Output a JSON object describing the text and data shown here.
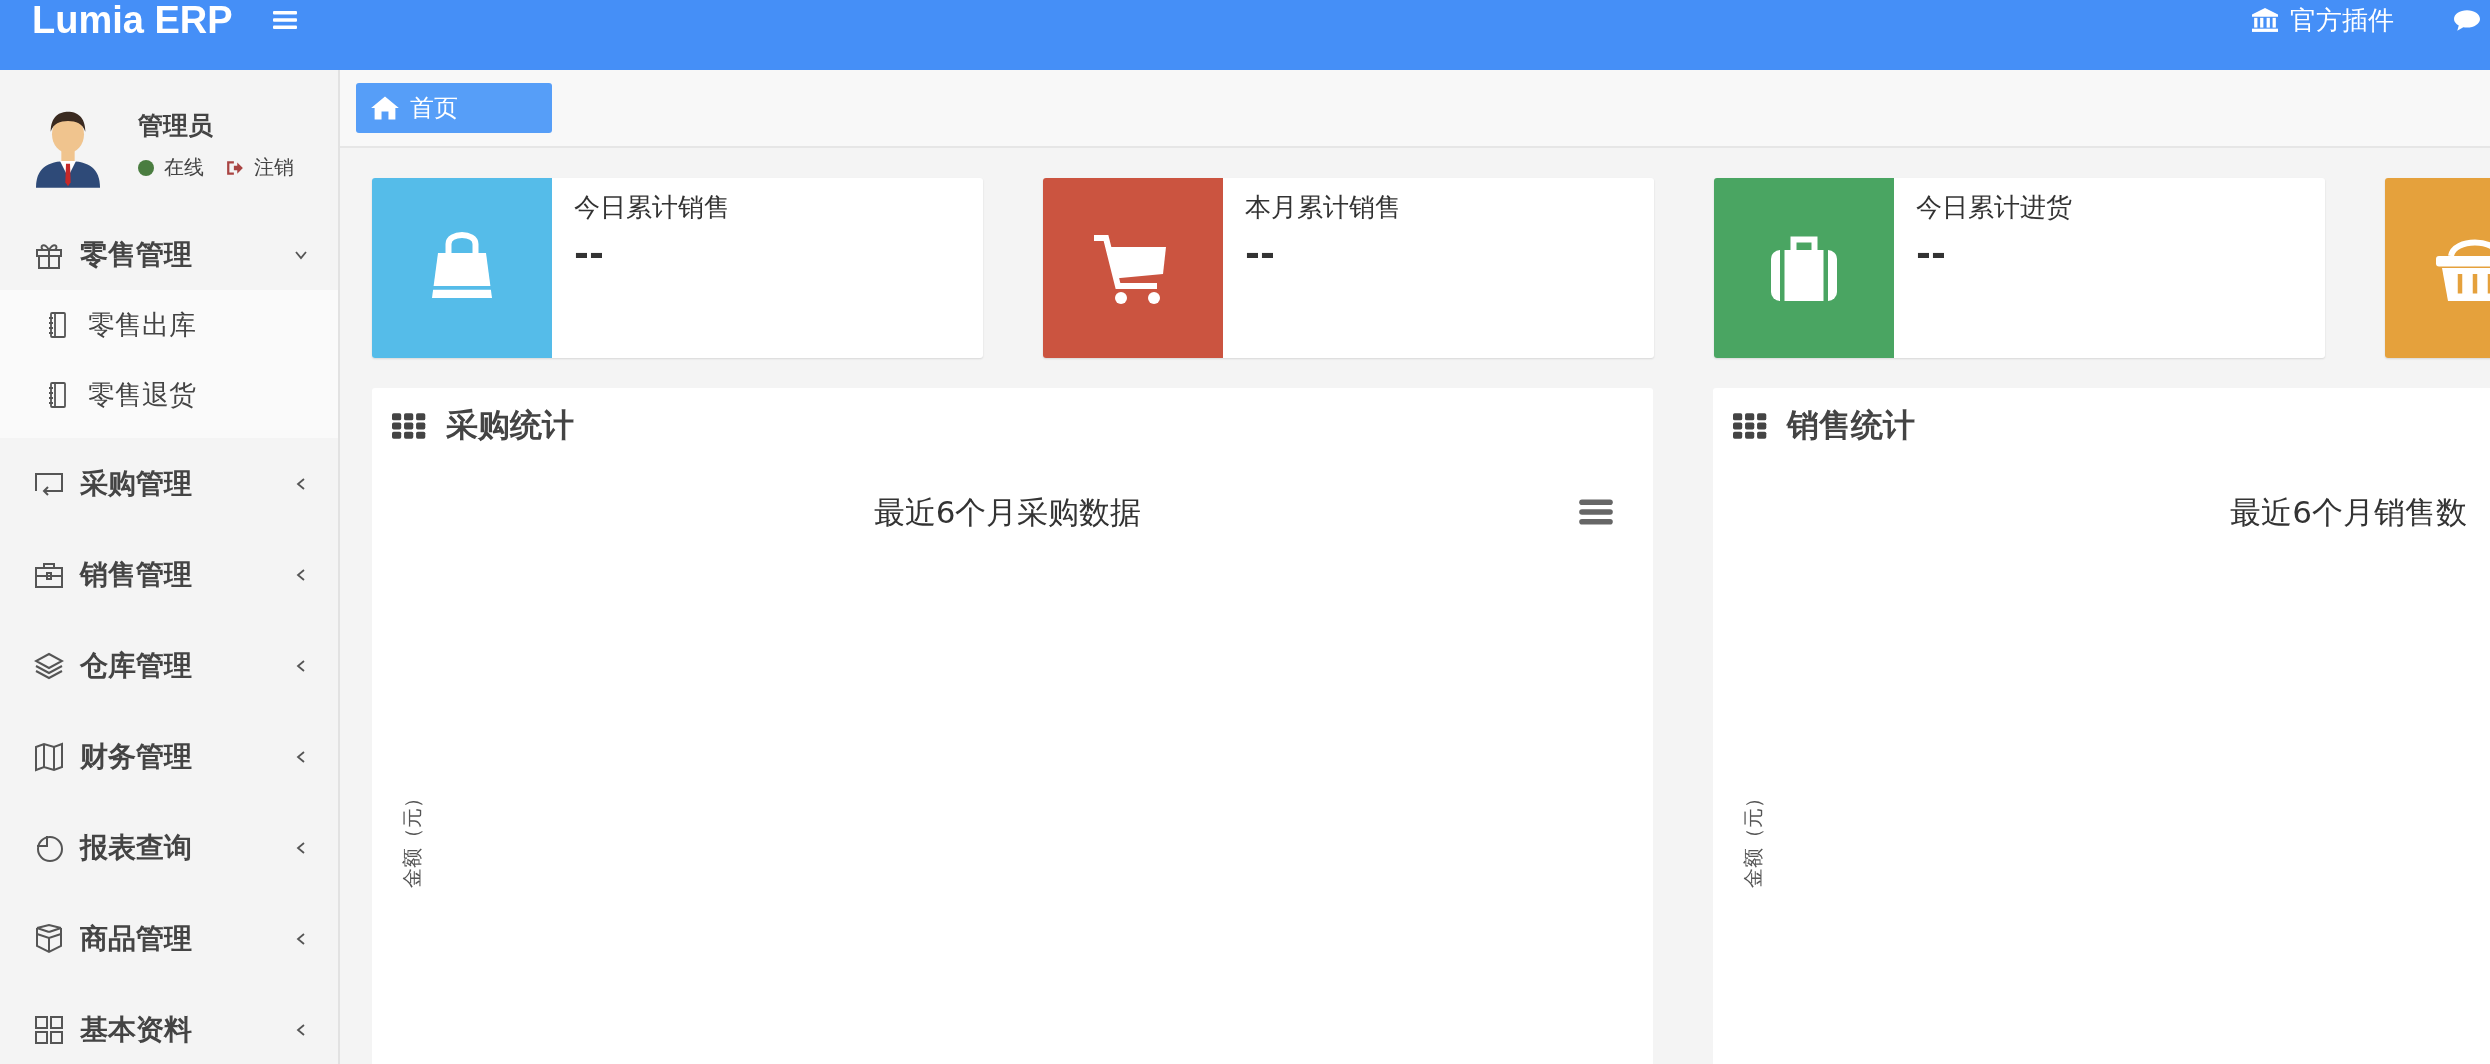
{
  "header": {
    "logo": "Lumia ERP",
    "links": [
      {
        "label": "官方插件"
      }
    ]
  },
  "user": {
    "name": "管理员",
    "online": true,
    "status": "在线",
    "logout": "注销"
  },
  "sidebar": {
    "items": [
      {
        "label": "零售管理",
        "expanded": true,
        "children": [
          {
            "label": "零售出库"
          },
          {
            "label": "零售退货"
          }
        ]
      },
      {
        "label": "采购管理",
        "expanded": false
      },
      {
        "label": "销售管理",
        "expanded": false
      },
      {
        "label": "仓库管理",
        "expanded": false
      },
      {
        "label": "财务管理",
        "expanded": false
      },
      {
        "label": "报表查询",
        "expanded": false
      },
      {
        "label": "商品管理",
        "expanded": false
      },
      {
        "label": "基本资料",
        "expanded": false
      }
    ]
  },
  "tabs": [
    {
      "label": "首页",
      "selected": true
    }
  ],
  "stats": [
    {
      "title": "今日累计销售",
      "value": "--",
      "color": "#55bce9"
    },
    {
      "title": "本月累计销售",
      "value": "--",
      "color": "#cb5440"
    },
    {
      "title": "今日累计进货",
      "value": "--",
      "color": "#4aa562"
    },
    {
      "color": "#e5a13c"
    }
  ],
  "panels": [
    {
      "title": "采购统计",
      "chart_title": "最近6个月采购数据",
      "ylabel": "金额（元）",
      "menu": true
    },
    {
      "title": "销售统计",
      "chart_title": "最近6个月销售数",
      "ylabel": "金额（元）",
      "menu": false
    }
  ]
}
